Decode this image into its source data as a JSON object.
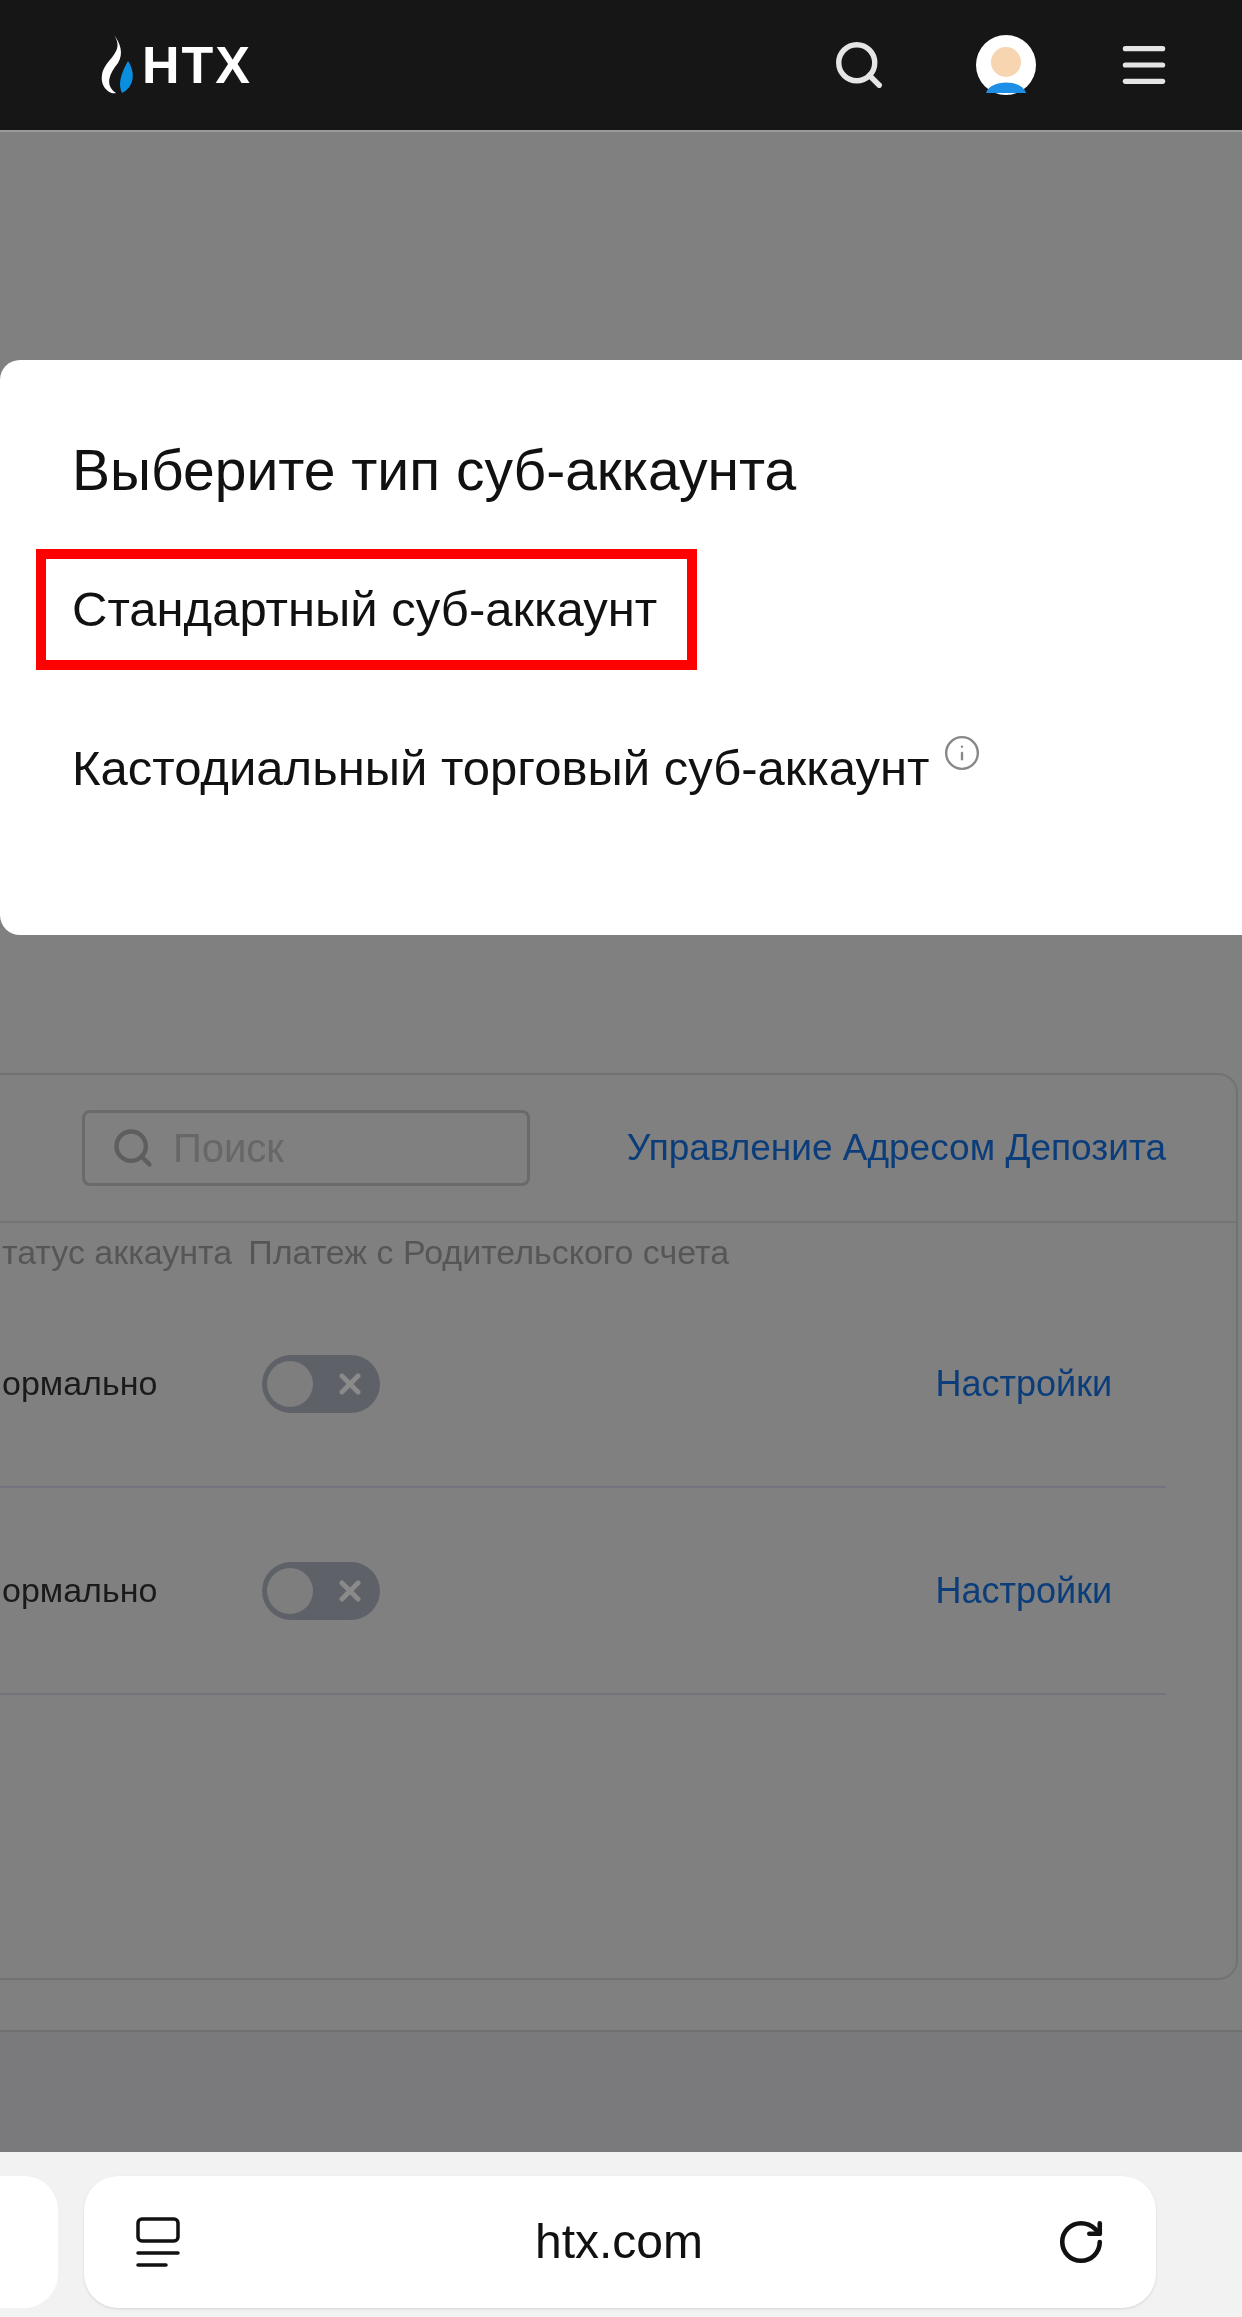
{
  "header": {
    "logo": "HTX"
  },
  "dialog": {
    "title": "Выберите тип суб-аккаунта",
    "options": [
      {
        "label": "Стандартный суб-аккаунт",
        "highlighted": true,
        "info": false
      },
      {
        "label": "Кастодиальный торговый суб-аккаунт",
        "highlighted": false,
        "info": true
      }
    ]
  },
  "search": {
    "placeholder": "Поиск"
  },
  "deposit_link": "Управление Адресом Депозита",
  "table": {
    "columns": [
      "татус аккаунта",
      "Платеж с Родительского счета"
    ],
    "rows": [
      {
        "status": "ормально",
        "payment_on": false,
        "action": "Настройки"
      },
      {
        "status": "ормально",
        "payment_on": false,
        "action": "Настройки"
      }
    ]
  },
  "browser": {
    "url": "htx.com"
  }
}
